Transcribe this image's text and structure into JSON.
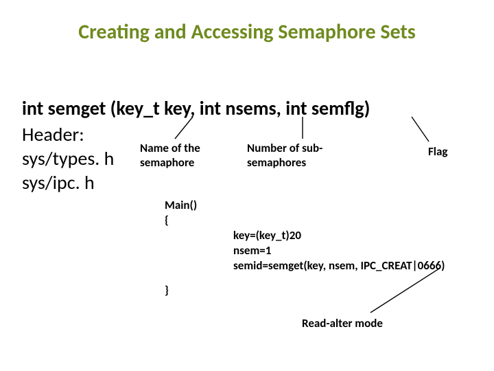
{
  "title": "Creating and Accessing Semaphore Sets",
  "signature": "int semget (key_t key, int nsems, int semflg)",
  "header": {
    "label": "Header:",
    "h1": "sys/types. h",
    "h2": "sys/ipc. h"
  },
  "labels": {
    "name": "Name of the semaphore",
    "num": "Number of sub-semaphores",
    "flag": "Flag"
  },
  "code": {
    "main_open": "Main()",
    "brace_open": "{",
    "l1": "key=(key_t)20",
    "l2": "nsem=1",
    "l3": "semid=semget(key, nsem, IPC_CREAT|0666)",
    "brace_close": "}"
  },
  "mode": "Read-alter mode"
}
